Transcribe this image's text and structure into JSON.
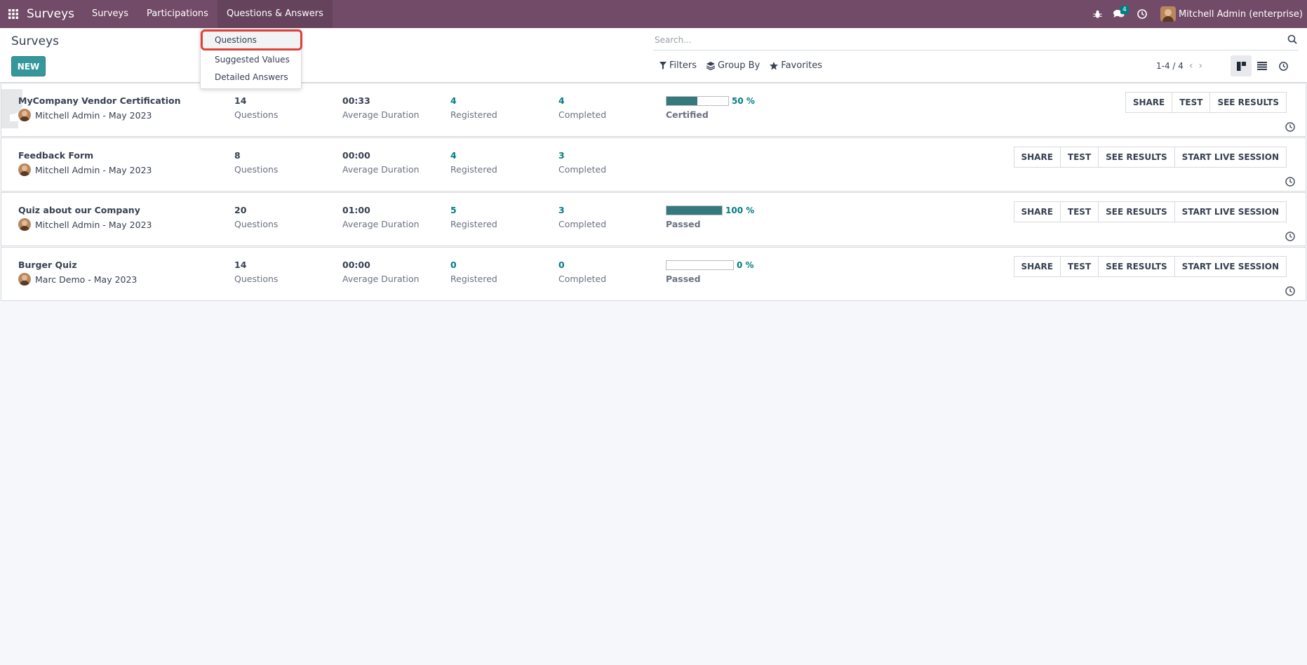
{
  "navbar": {
    "app_name": "Surveys",
    "menu": [
      "Surveys",
      "Participations",
      "Questions & Answers"
    ],
    "message_count": "4",
    "user": "Mitchell Admin (enterprise)"
  },
  "control": {
    "title": "Surveys",
    "new_label": "NEW",
    "search_placeholder": "Search...",
    "filters": "Filters",
    "group_by": "Group By",
    "favorites": "Favorites",
    "pager": "1-4 / 4"
  },
  "dropdown": {
    "items": [
      "Questions",
      "Suggested Values",
      "Detailed Answers"
    ]
  },
  "labels": {
    "questions": "Questions",
    "avg_duration": "Average Duration",
    "registered": "Registered",
    "completed": "Completed"
  },
  "actions": {
    "share": "SHARE",
    "test": "TEST",
    "see_results": "SEE RESULTS",
    "start_live": "START LIVE SESSION"
  },
  "surveys": [
    {
      "title": "MyCompany Vendor Certification",
      "author": "Mitchell Admin - May 2023",
      "questions": "14",
      "duration": "00:33",
      "registered": "4",
      "completed": "4",
      "progress": 50,
      "progress_label": "50 %",
      "status": "Certified",
      "live_session": false
    },
    {
      "title": "Feedback Form",
      "author": "Mitchell Admin - May 2023",
      "questions": "8",
      "duration": "00:00",
      "registered": "4",
      "completed": "3",
      "progress": null,
      "progress_label": "",
      "status": "",
      "live_session": true
    },
    {
      "title": "Quiz about our Company",
      "author": "Mitchell Admin - May 2023",
      "questions": "20",
      "duration": "01:00",
      "registered": "5",
      "completed": "3",
      "progress": 100,
      "progress_label": "100 %",
      "status": "Passed",
      "live_session": true
    },
    {
      "title": "Burger Quiz",
      "author": "Marc Demo - May 2023",
      "questions": "14",
      "duration": "00:00",
      "registered": "0",
      "completed": "0",
      "progress": 0,
      "progress_label": "0 %",
      "status": "Passed",
      "live_session": true
    }
  ],
  "colors": {
    "navbar": "#714b67",
    "primary": "#35979c",
    "teal_text": "#017e84",
    "highlight_border": "#e0423a"
  }
}
